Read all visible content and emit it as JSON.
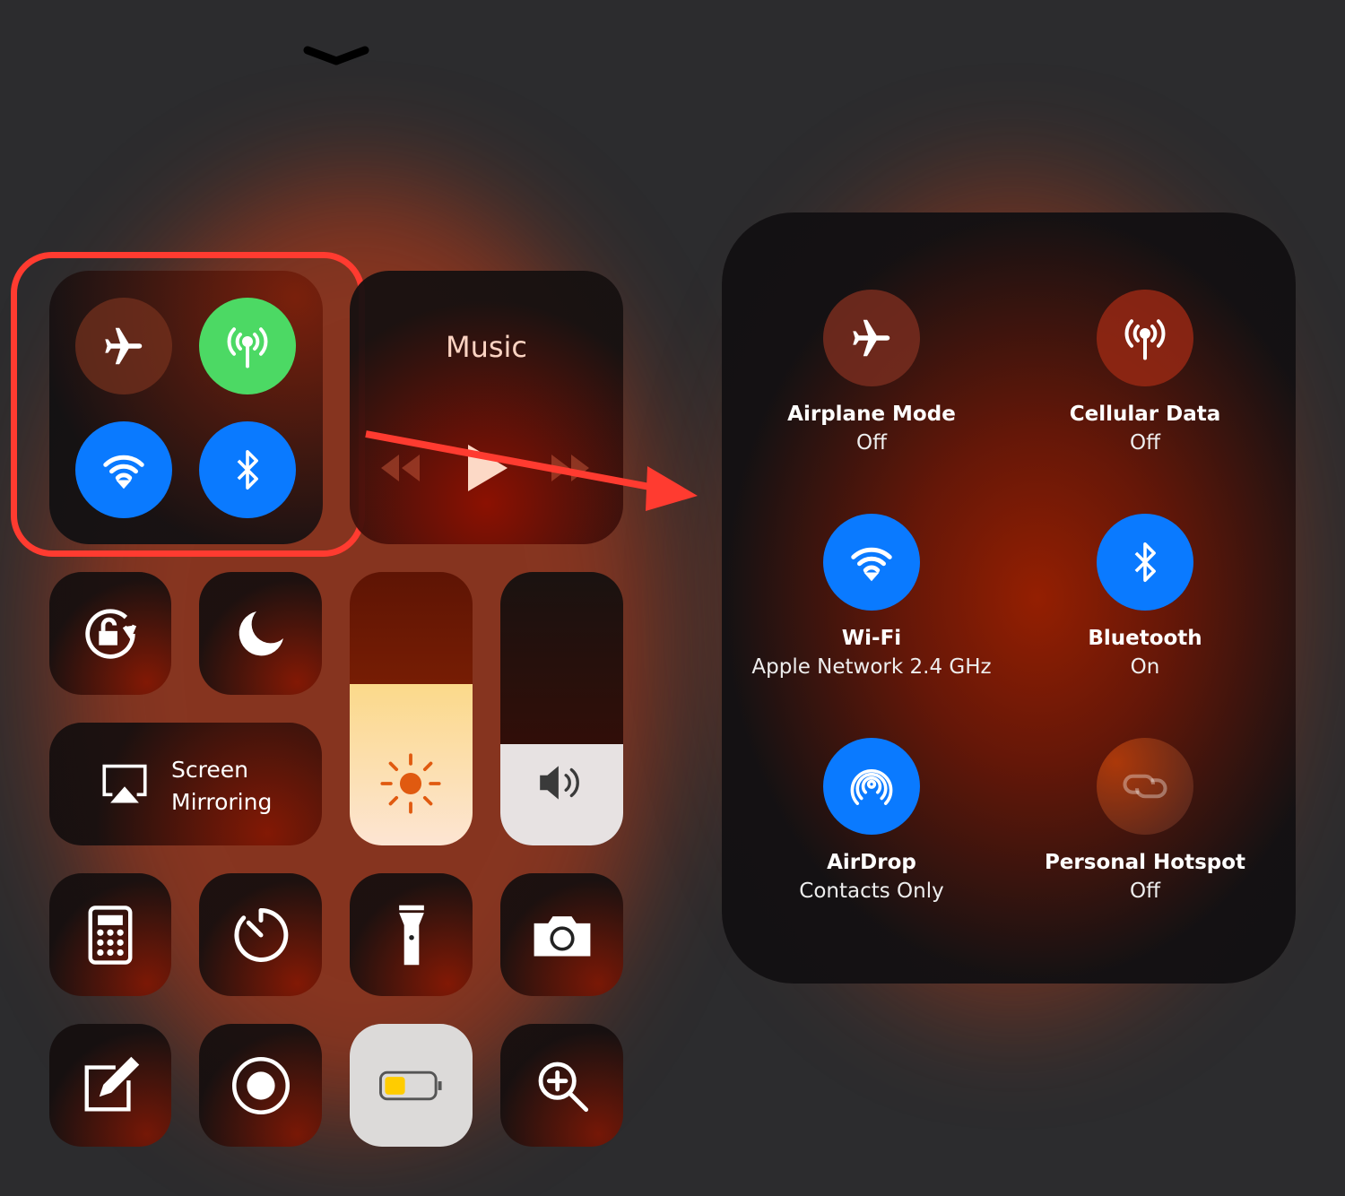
{
  "colors": {
    "accent_blue": "#0a7aff",
    "cellular_green": "#4cd964",
    "annotation_red": "#ff3b30",
    "background": "#2c2c2e"
  },
  "left_panel": {
    "dismiss_icon": "chevron-down-icon",
    "connectivity": {
      "airplane_on": false,
      "cellular_on": true,
      "wifi_on": true,
      "bluetooth_on": true
    },
    "music": {
      "title": "Music"
    },
    "screen_mirroring": {
      "line1": "Screen",
      "line2": "Mirroring"
    },
    "brightness_level": 0.59,
    "volume_level": 0.37,
    "tiles": [
      "orientation-lock-icon",
      "do-not-disturb-icon",
      "calculator-icon",
      "timer-icon",
      "flashlight-icon",
      "camera-icon",
      "notes-icon",
      "screen-record-icon",
      "low-power-mode-icon",
      "magnifier-icon"
    ]
  },
  "right_panel": {
    "items": [
      {
        "label": "Airplane Mode",
        "status": "Off"
      },
      {
        "label": "Cellular Data",
        "status": "Off"
      },
      {
        "label": "Wi-Fi",
        "status": "Apple Network 2.4 GHz"
      },
      {
        "label": "Bluetooth",
        "status": "On"
      },
      {
        "label": "AirDrop",
        "status": "Contacts Only"
      },
      {
        "label": "Personal Hotspot",
        "status": "Off"
      }
    ]
  }
}
